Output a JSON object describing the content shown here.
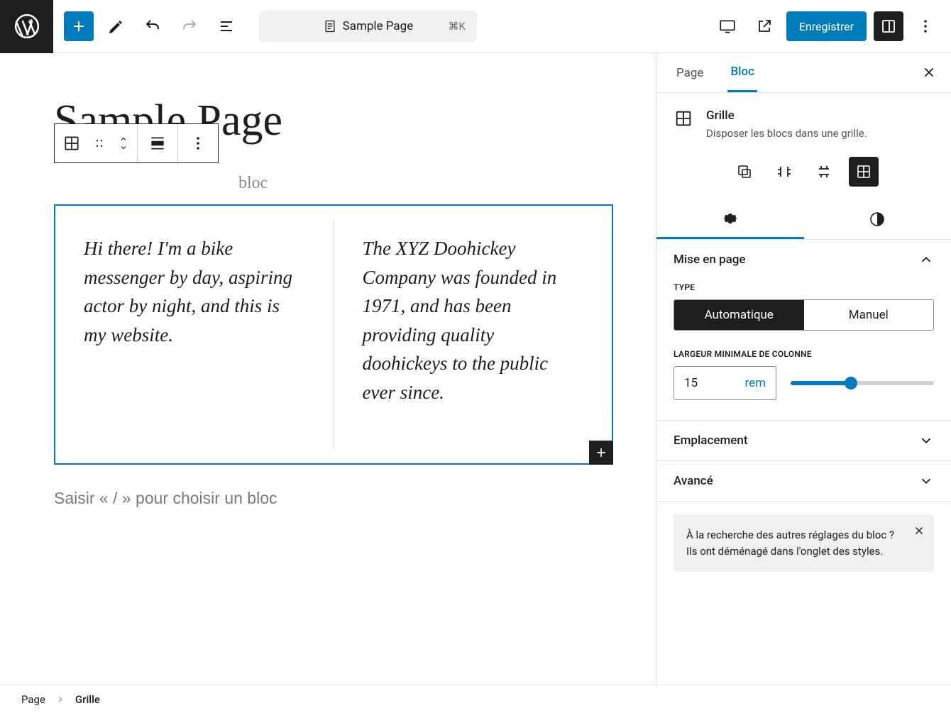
{
  "toolbar": {
    "document_title": "Sample Page",
    "shortcut": "⌘K",
    "save_label": "Enregistrer"
  },
  "canvas": {
    "page_title": "Sample Page",
    "toolbar_placeholder_suffix": "bloc",
    "grid_cells": [
      "Hi there! I'm a bike messenger by day, aspiring actor by night, and this is my website.",
      "The XYZ Doohickey Company was founded in 1971, and has been providing quality doohickeys to the public ever since."
    ],
    "slash_hint": "Saisir « / » pour choisir un bloc"
  },
  "sidebar": {
    "tabs": {
      "page": "Page",
      "block": "Bloc"
    },
    "block": {
      "name": "Grille",
      "description": "Disposer les blocs dans une grille."
    },
    "panels": {
      "layout": {
        "title": "Mise en page",
        "type_label": "TYPE",
        "type_options": {
          "auto": "Automatique",
          "manual": "Manuel"
        },
        "min_width_label": "LARGEUR MINIMALE DE COLONNE",
        "min_width_value": "15",
        "min_width_unit": "rem"
      },
      "position": {
        "title": "Emplacement"
      },
      "advanced": {
        "title": "Avancé"
      }
    },
    "notice": "À la recherche des autres réglages du bloc ? Ils ont déménagé dans l'onglet des styles."
  },
  "breadcrumb": {
    "root": "Page",
    "current": "Grille"
  }
}
